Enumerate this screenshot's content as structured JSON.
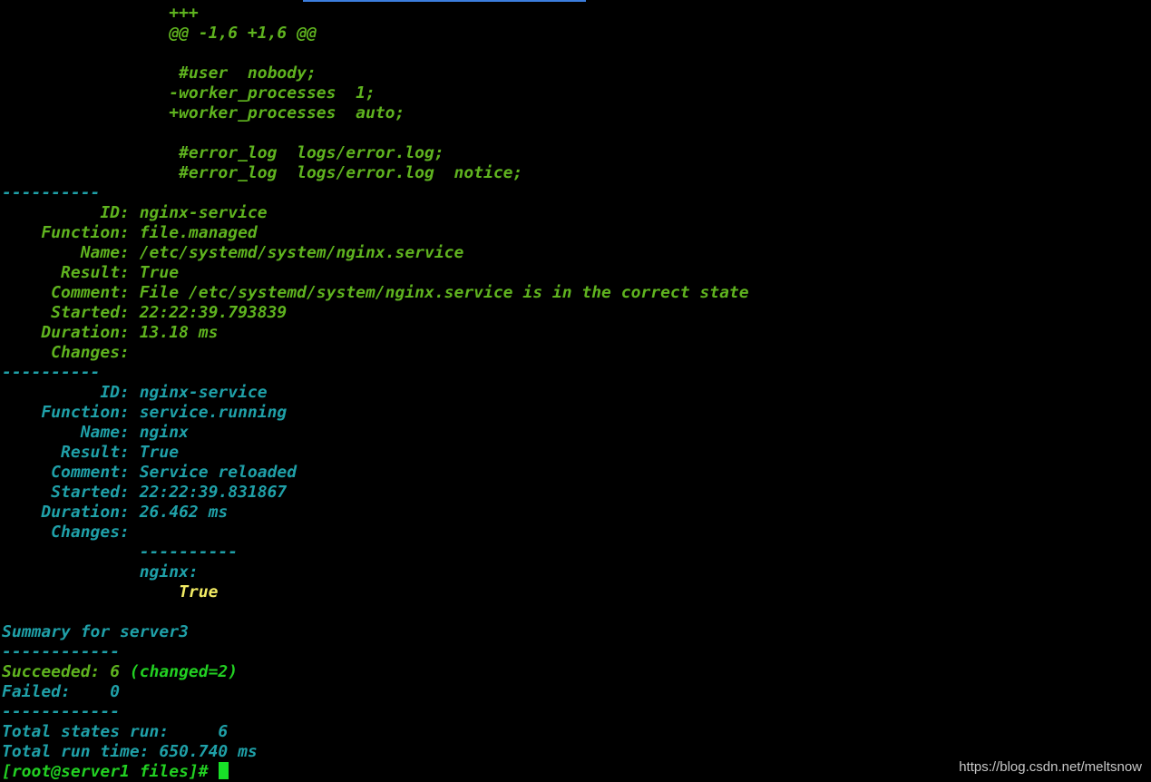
{
  "colors": {
    "background": "#000000",
    "green": "#5fb31f",
    "teal": "#1fa0a8",
    "bright_green": "#22d022",
    "yellow": "#f2ec64"
  },
  "lines": [
    {
      "text": "                 +++",
      "color": "green"
    },
    {
      "text": "                 @@ -1,6 +1,6 @@",
      "color": "green"
    },
    {
      "text": "",
      "color": "green"
    },
    {
      "text": "                  #user  nobody;",
      "color": "green"
    },
    {
      "text": "                 -worker_processes  1;",
      "color": "green"
    },
    {
      "text": "                 +worker_processes  auto;",
      "color": "green"
    },
    {
      "text": "",
      "color": "green"
    },
    {
      "text": "                  #error_log  logs/error.log;",
      "color": "green"
    },
    {
      "text": "                  #error_log  logs/error.log  notice;",
      "color": "green"
    },
    {
      "text": "----------",
      "color": "teal"
    },
    {
      "text": "          ID: nginx-service",
      "color": "green"
    },
    {
      "text": "    Function: file.managed",
      "color": "green"
    },
    {
      "text": "        Name: /etc/systemd/system/nginx.service",
      "color": "green"
    },
    {
      "text": "      Result: True",
      "color": "green"
    },
    {
      "text": "     Comment: File /etc/systemd/system/nginx.service is in the correct state",
      "color": "green"
    },
    {
      "text": "     Started: 22:22:39.793839",
      "color": "green"
    },
    {
      "text": "    Duration: 13.18 ms",
      "color": "green"
    },
    {
      "text": "     Changes:",
      "color": "green"
    },
    {
      "text": "----------",
      "color": "teal"
    },
    {
      "text": "          ID: nginx-service",
      "color": "teal"
    },
    {
      "text": "    Function: service.running",
      "color": "teal"
    },
    {
      "text": "        Name: nginx",
      "color": "teal"
    },
    {
      "text": "      Result: True",
      "color": "teal"
    },
    {
      "text": "     Comment: Service reloaded",
      "color": "teal"
    },
    {
      "text": "     Started: 22:22:39.831867",
      "color": "teal"
    },
    {
      "text": "    Duration: 26.462 ms",
      "color": "teal"
    },
    {
      "text": "     Changes:",
      "color": "teal"
    },
    {
      "text": "              ----------",
      "color": "teal"
    },
    {
      "text": "              nginx:",
      "color": "teal"
    },
    {
      "text": "                  True",
      "color": "yellow"
    },
    {
      "text": "",
      "color": "teal"
    },
    {
      "text": "Summary for server3",
      "color": "teal"
    },
    {
      "text": "------------",
      "color": "teal"
    },
    {
      "segments": [
        {
          "text": "Succeeded: 6 ",
          "color": "green"
        },
        {
          "text": "(changed=2)",
          "color": "bright"
        }
      ]
    },
    {
      "text": "Failed:    0",
      "color": "teal"
    },
    {
      "text": "------------",
      "color": "teal"
    },
    {
      "text": "Total states run:     6",
      "color": "teal"
    },
    {
      "text": "Total run time: 650.740 ms",
      "color": "teal"
    },
    {
      "text": "[root@server1 files]# ",
      "color": "bright",
      "cursor": true
    }
  ],
  "watermark": "https://blog.csdn.net/meltsnow"
}
